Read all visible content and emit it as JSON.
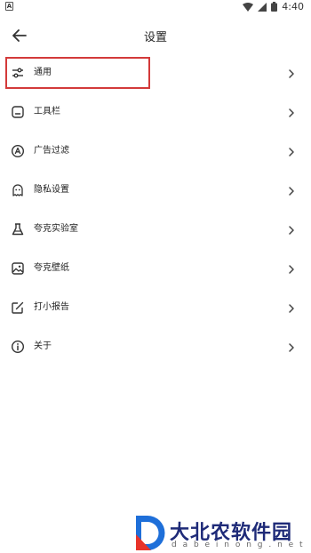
{
  "status_bar": {
    "time": "4:40"
  },
  "header": {
    "title": "设置"
  },
  "menu": [
    {
      "label": "通用",
      "icon": "sliders-icon",
      "selected": true
    },
    {
      "label": "工具栏",
      "icon": "toolbar-icon"
    },
    {
      "label": "广告过滤",
      "icon": "ad-filter-icon"
    },
    {
      "label": "隐私设置",
      "icon": "privacy-icon"
    },
    {
      "label": "夸克实验室",
      "icon": "flask-icon"
    },
    {
      "label": "夸克壁纸",
      "icon": "wallpaper-icon"
    },
    {
      "label": "打小报告",
      "icon": "report-icon"
    },
    {
      "label": "关于",
      "icon": "info-icon"
    }
  ],
  "watermark": {
    "name": "大北农软件园",
    "url": "d a b e i n o n g . n e t"
  },
  "colors": {
    "highlight": "#d33a3a",
    "watermark": "#1e2a78"
  }
}
